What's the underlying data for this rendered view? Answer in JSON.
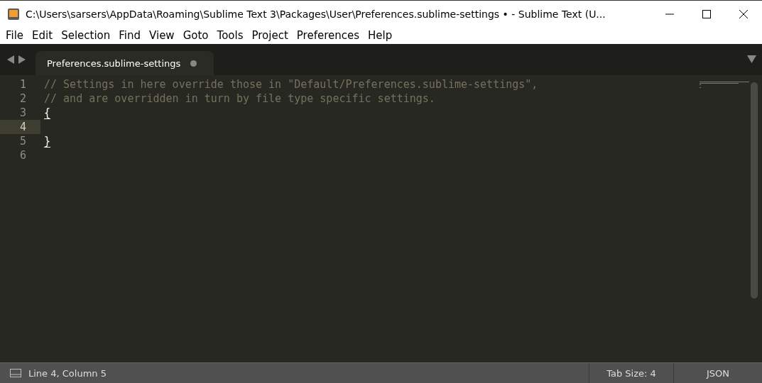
{
  "window": {
    "title": "C:\\Users\\sarsers\\AppData\\Roaming\\Sublime Text 3\\Packages\\User\\Preferences.sublime-settings • - Sublime Text (U..."
  },
  "menu": [
    "File",
    "Edit",
    "Selection",
    "Find",
    "View",
    "Goto",
    "Tools",
    "Project",
    "Preferences",
    "Help"
  ],
  "tabs": [
    {
      "label": "Preferences.sublime-settings",
      "selected": true,
      "modified": true
    }
  ],
  "editor": {
    "lines": [
      {
        "number": "1",
        "text": "// Settings in here override those in \"Default/Preferences.sublime-settings\",",
        "kind": "comment",
        "current": false
      },
      {
        "number": "2",
        "text": "// and are overridden in turn by file type specific settings.",
        "kind": "comment",
        "current": false
      },
      {
        "number": "3",
        "text": "{",
        "kind": "bracket",
        "current": false
      },
      {
        "number": "4",
        "kind": "plain",
        "current": true
      },
      {
        "number": "5",
        "text": "}",
        "kind": "bracket",
        "current": false
      },
      {
        "number": "6",
        "kind": "plain",
        "current": false
      }
    ]
  },
  "status_bar": {
    "position": "Line 4, Column 5",
    "tab_size": "Tab Size: 4",
    "syntax": "JSON"
  }
}
